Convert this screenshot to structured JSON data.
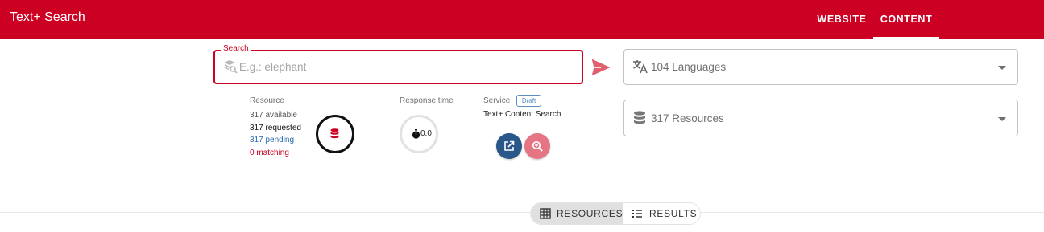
{
  "app": {
    "title": "Text+ Search"
  },
  "nav": {
    "website": "WEBSITE",
    "content": "CONTENT"
  },
  "search": {
    "label": "Search",
    "placeholder": "E.g.: elephant"
  },
  "languages": {
    "value": "104 Languages"
  },
  "resources_select": {
    "value": "317 Resources"
  },
  "resource_stats": {
    "heading": "Resource",
    "available": "317 available",
    "requested": "317 requested",
    "pending": "317 pending",
    "matching": "0 matching"
  },
  "response_time": {
    "heading": "Response time",
    "value": "0.0"
  },
  "service": {
    "heading": "Service",
    "badge": "Draft",
    "name": "Text+ Content Search"
  },
  "view_toggle": {
    "resources": "RESOURCES",
    "results": "RESULTS",
    "selected": "resources"
  },
  "colors": {
    "brand": "#cc0022",
    "pending": "#2a6bb0",
    "matching": "#cc0022",
    "open_button": "#2a578a",
    "zoom_button": "#e57484"
  },
  "icons": [
    "search-database-icon",
    "send-icon",
    "translate-icon",
    "database-icon",
    "timer-icon",
    "open-external-icon",
    "zoom-icon",
    "grid-icon",
    "list-icon",
    "chevron-down-icon"
  ]
}
